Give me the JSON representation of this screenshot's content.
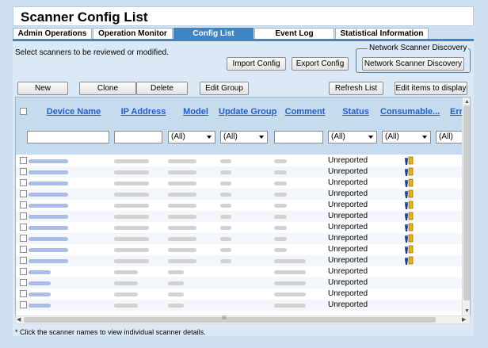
{
  "page_title": "Scanner Config List",
  "tabs": [
    {
      "label": "Admin Operations",
      "active": false
    },
    {
      "label": "Operation Monitor",
      "active": false
    },
    {
      "label": "Config List",
      "active": true
    },
    {
      "label": "Event Log",
      "active": false
    },
    {
      "label": "Statistical Information",
      "active": false
    }
  ],
  "instruction": "Select scanners to be reviewed or modified.",
  "network_scanner_discovery": {
    "legend": "Network Scanner Discovery",
    "button": "Network Scanner Discovery"
  },
  "toolbar": {
    "import_config": "Import Config",
    "export_config": "Export Config",
    "new": "New",
    "clone": "Clone",
    "delete": "Delete",
    "edit_group": "Edit Group",
    "refresh_list": "Refresh List",
    "edit_items": "Edit items to display"
  },
  "grid": {
    "columns": [
      {
        "label": "Device Name",
        "filter_type": "text",
        "filter_value": ""
      },
      {
        "label": "IP Address",
        "filter_type": "text",
        "filter_value": ""
      },
      {
        "label": "Model",
        "filter_type": "select",
        "filter_value": "(All)"
      },
      {
        "label": "Update Group",
        "filter_type": "select",
        "filter_value": "(All)"
      },
      {
        "label": "Comment",
        "filter_type": "text",
        "filter_value": ""
      },
      {
        "label": "Status",
        "filter_type": "select",
        "filter_value": "(All)"
      },
      {
        "label": "Consumable...",
        "filter_type": "select",
        "filter_value": "(All)"
      },
      {
        "label": "Erro",
        "filter_type": "select",
        "filter_value": "(All)"
      }
    ],
    "rows": [
      {
        "status": "Unreported",
        "consumable_icon": true
      },
      {
        "status": "Unreported",
        "consumable_icon": true
      },
      {
        "status": "Unreported",
        "consumable_icon": true
      },
      {
        "status": "Unreported",
        "consumable_icon": true
      },
      {
        "status": "Unreported",
        "consumable_icon": true
      },
      {
        "status": "Unreported",
        "consumable_icon": true
      },
      {
        "status": "Unreported",
        "consumable_icon": true
      },
      {
        "status": "Unreported",
        "consumable_icon": true
      },
      {
        "status": "Unreported",
        "consumable_icon": true
      },
      {
        "status": "Unreported",
        "consumable_icon": true
      },
      {
        "status": "Unreported",
        "consumable_icon": false
      },
      {
        "status": "Unreported",
        "consumable_icon": false
      },
      {
        "status": "Unreported",
        "consumable_icon": false
      },
      {
        "status": "Unreported",
        "consumable_icon": false
      }
    ]
  },
  "horizontal_scroll_grip": "III",
  "footnote": "* Click the scanner names to view individual scanner details.",
  "colors": {
    "accent": "#3d85c6",
    "header_bg": "#c7dbef",
    "panel_bg": "#dbe8f5",
    "link": "#1f5fcf"
  }
}
